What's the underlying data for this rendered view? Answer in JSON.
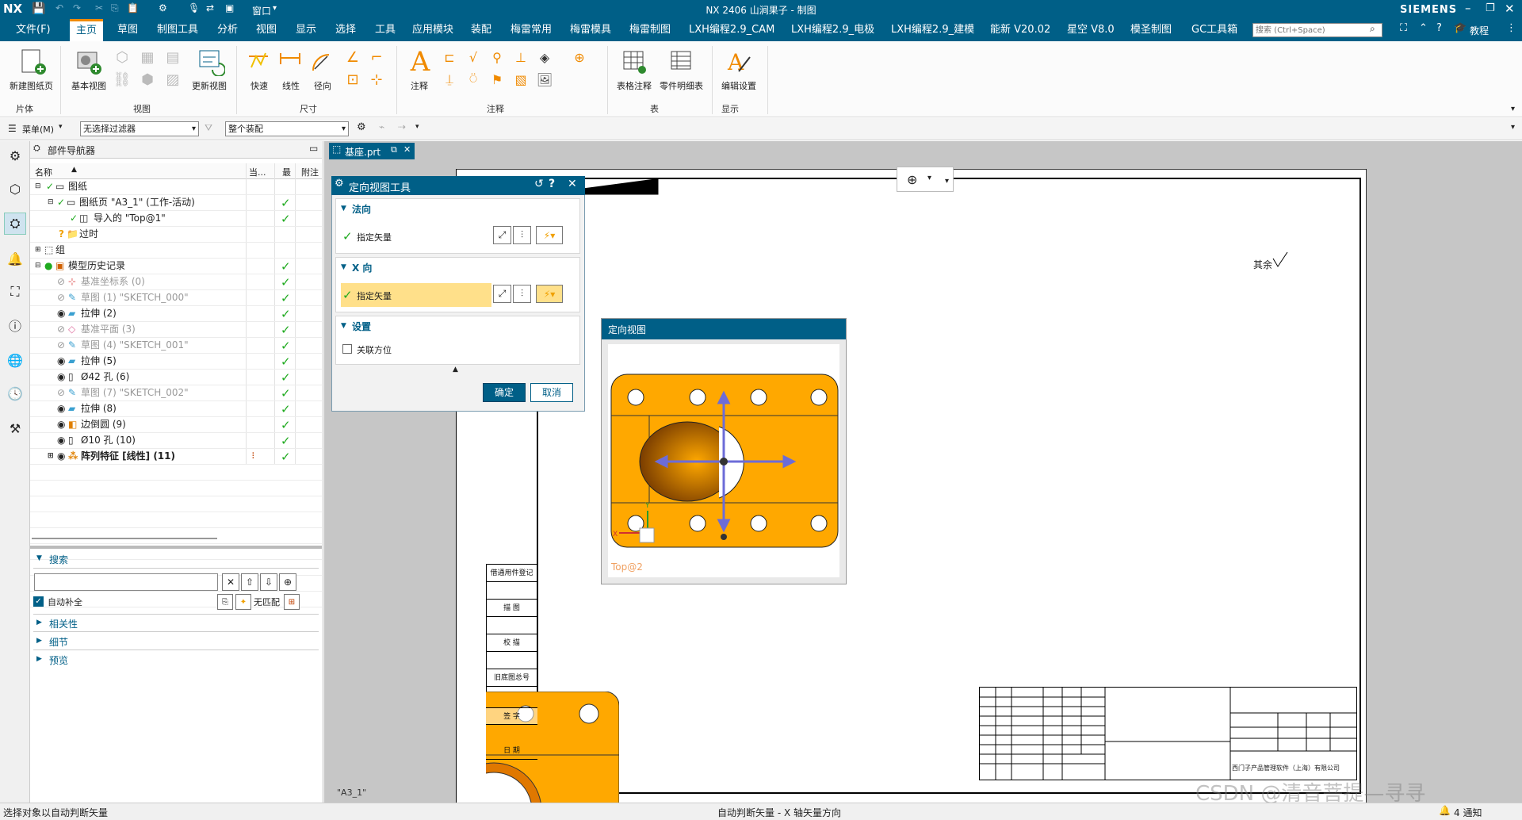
{
  "titlebar": {
    "logo": "NX",
    "title": "NX 2406 山涧果子 - 制图",
    "window_menu": "窗口",
    "brand": "SIEMENS"
  },
  "menubar": {
    "file": "文件(F)",
    "items": [
      "主页",
      "草图",
      "制图工具",
      "分析",
      "视图",
      "显示",
      "选择",
      "工具",
      "应用模块",
      "装配",
      "梅雷常用",
      "梅雷模具",
      "梅雷制图",
      "LXH编程2.9_CAM",
      "LXH编程2.9_电极",
      "LXH编程2.9_建模",
      "能新 V20.02",
      "星空 V8.0",
      "模圣制图",
      "GC工具箱"
    ],
    "search_placeholder": "搜索 (Ctrl+Space)",
    "tutorial": "教程"
  },
  "ribbon": {
    "buttons": {
      "new_sheet": "新建图纸页",
      "base_view": "基本视图",
      "update_view": "更新视图",
      "quick": "快速",
      "linear": "线性",
      "radial": "径向",
      "note": "注释",
      "table_note": "表格注释",
      "parts_list": "零件明细表",
      "edit_settings": "编辑设置"
    },
    "groups": [
      "片体",
      "视图",
      "尺寸",
      "注释",
      "表",
      "显示"
    ]
  },
  "selection_bar": {
    "menu": "菜单(M)",
    "filter": "无选择过滤器",
    "scope": "整个装配"
  },
  "doc_tab": {
    "name": "基座.prt"
  },
  "navigator": {
    "title": "部件导航器",
    "columns": {
      "name": "名称",
      "current": "当...",
      "latest": "最",
      "note": "附注"
    },
    "rows": [
      {
        "label": "图纸",
        "grey": false,
        "check": false
      },
      {
        "label": "图纸页 \"A3_1\" (工作-活动)",
        "grey": false,
        "check": true
      },
      {
        "label": "导入的 \"Top@1\"",
        "grey": false,
        "check": true
      },
      {
        "label": "过时",
        "grey": false,
        "check": false
      },
      {
        "label": "组",
        "grey": false,
        "check": false
      },
      {
        "label": "模型历史记录",
        "grey": false,
        "check": true
      },
      {
        "label": "基准坐标系 (0)",
        "grey": true,
        "check": true
      },
      {
        "label": "草图 (1) \"SKETCH_000\"",
        "grey": true,
        "check": true
      },
      {
        "label": "拉伸 (2)",
        "grey": false,
        "check": true
      },
      {
        "label": "基准平面 (3)",
        "grey": true,
        "check": true
      },
      {
        "label": "草图 (4) \"SKETCH_001\"",
        "grey": true,
        "check": true
      },
      {
        "label": "拉伸 (5)",
        "grey": false,
        "check": true
      },
      {
        "label": "Ø42 孔 (6)",
        "grey": false,
        "check": true
      },
      {
        "label": "草图 (7) \"SKETCH_002\"",
        "grey": true,
        "check": true
      },
      {
        "label": "拉伸 (8)",
        "grey": false,
        "check": true
      },
      {
        "label": "边倒圆 (9)",
        "grey": false,
        "check": true
      },
      {
        "label": "Ø10 孔 (10)",
        "grey": false,
        "check": true
      },
      {
        "label": "阵列特征 [线性] (11)",
        "grey": false,
        "check": true
      }
    ],
    "search_title": "搜索",
    "auto_complete": "自动补全",
    "no_match": "无匹配",
    "sections": [
      "相关性",
      "细节",
      "预览"
    ]
  },
  "dialog": {
    "title": "定向视图工具",
    "normal_section": "法向",
    "x_section": "X 向",
    "specify_vector": "指定矢量",
    "settings_section": "设置",
    "associative": "关联方位",
    "ok": "确定",
    "cancel": "取消"
  },
  "preview": {
    "title": "定向视图",
    "view_label": "Top@2"
  },
  "drawing": {
    "sheet_label": "\"A3_1\"",
    "roughness_text": "其余",
    "left_column": [
      "借通用件登记",
      "描 图",
      "校 描",
      "旧底图总号",
      "签 字",
      "日 期"
    ],
    "company": "西门子产品管理软件（上海）有限公司"
  },
  "status": {
    "left": "选择对象以自动判断矢量",
    "center": "自动判断矢量 - X 轴矢量方向",
    "notifications": "4 通知"
  },
  "watermark": "CSDN @清音菩提—寻寻"
}
